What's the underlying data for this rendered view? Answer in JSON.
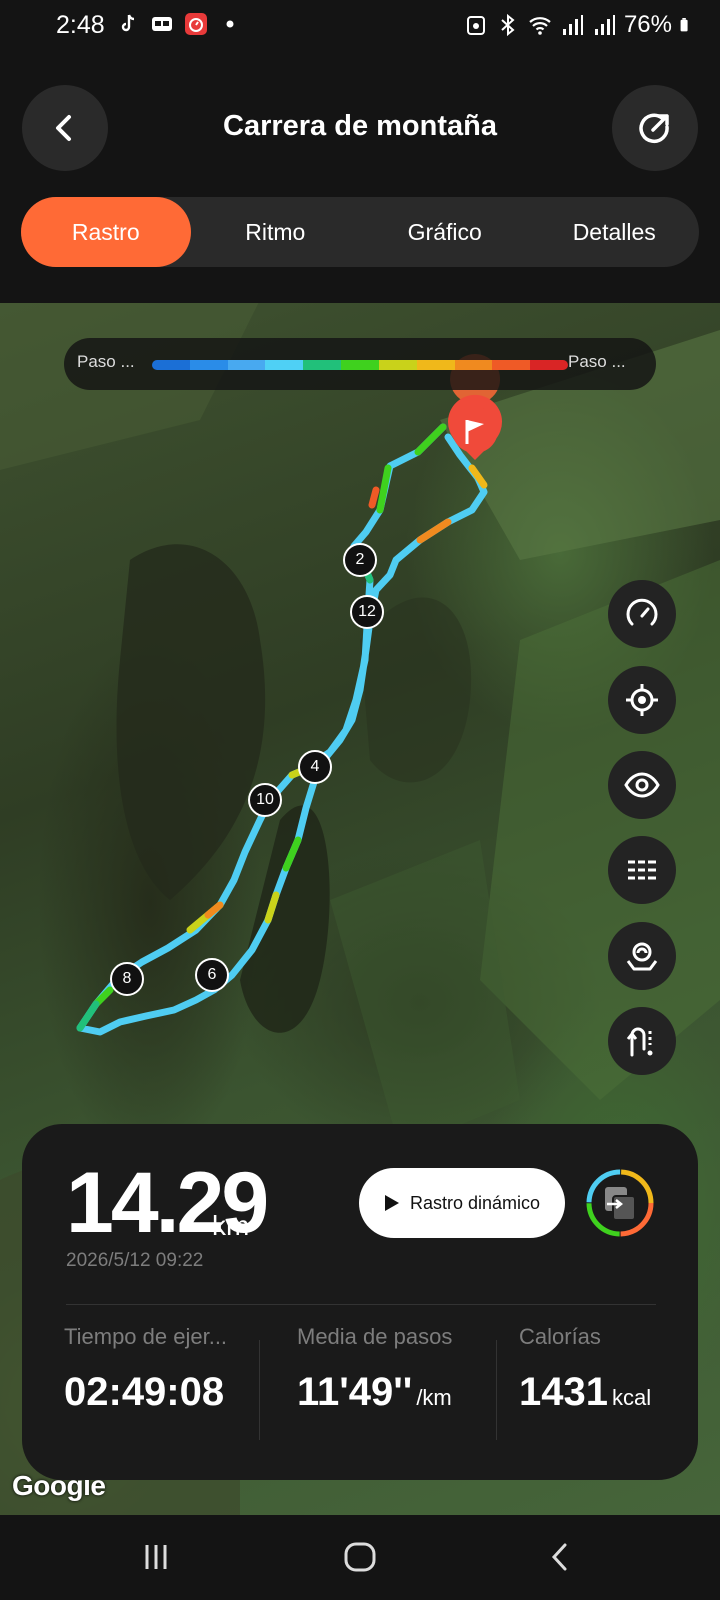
{
  "status_bar": {
    "time": "2:48",
    "battery": "76%",
    "icons": [
      "tiktok-icon",
      "app-icon",
      "stopwatch-icon",
      "dot-icon",
      "lock-icon",
      "bluetooth-icon",
      "wifi-icon",
      "signal-icon",
      "signal-icon",
      "battery-icon"
    ]
  },
  "header": {
    "title": "Carrera de montaña",
    "back_icon": "back-icon",
    "share_icon": "share-icon"
  },
  "tabs": [
    {
      "label": "Rastro",
      "active": true
    },
    {
      "label": "Ritmo",
      "active": false
    },
    {
      "label": "Gráfico",
      "active": false
    },
    {
      "label": "Detalles",
      "active": false
    }
  ],
  "legend": {
    "left_label": "Paso ...",
    "right_label": "Paso ...",
    "colors": [
      "#1b6fd6",
      "#2a8ce8",
      "#48a9f0",
      "#4fd0f5",
      "#21c07a",
      "#3fd11e",
      "#c9d21a",
      "#f0b81a",
      "#f08a1f",
      "#ef5a26",
      "#d92525"
    ]
  },
  "map": {
    "markers": [
      "2",
      "12",
      "4",
      "10",
      "8",
      "6"
    ],
    "attribution": "Google",
    "side_buttons": [
      "speedometer-icon",
      "locate-icon",
      "eye-icon",
      "layers-list-icon",
      "map-style-icon",
      "route-icon"
    ]
  },
  "summary": {
    "distance": "14.29",
    "distance_unit": "km",
    "datetime": "2026/5/12 09:22",
    "dynamic_button": "Rastro dinámico",
    "stats": [
      {
        "label": "Tiempo de ejer...",
        "value": "02:49:08",
        "unit": ""
      },
      {
        "label": "Media de pasos",
        "value": "11'49''",
        "unit": "/km"
      },
      {
        "label": "Calorías",
        "value": "1431",
        "unit": "kcal"
      }
    ]
  },
  "nav_bar": [
    "recents-icon",
    "home-icon",
    "back-nav-icon"
  ],
  "accent_color": "#ff6a36"
}
